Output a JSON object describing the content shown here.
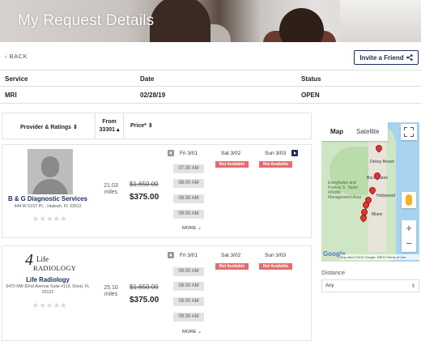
{
  "header": {
    "title": "My Request Details"
  },
  "nav": {
    "back_label": "BACK",
    "invite_label": "Invite a Friend",
    "invite_icon": "share-icon"
  },
  "request": {
    "headers": [
      "Service",
      "Date",
      "Status"
    ],
    "values": [
      "MRI",
      "02/28/19",
      "OPEN"
    ]
  },
  "list_header": {
    "provider": "Provider & Ratings",
    "from_label": "From",
    "from_zip": "33301",
    "price": "Price*"
  },
  "providers": [
    {
      "name": "B & G Diagnostic Services",
      "address": "444 W 51ST PL , Hialeah, FL 33012",
      "distance": "21.03",
      "distance_unit": "miles",
      "old_price": "$1,650.00",
      "price": "$375.00",
      "rating": 0,
      "days": [
        "Fri 3/01",
        "Sat 3/02",
        "Sun 3/03"
      ],
      "slots": [
        "07:30 AM",
        "08:00 AM",
        "08:30 AM",
        "09:00 AM"
      ],
      "unavailable": "Not Available",
      "more": "MORE ⌄"
    },
    {
      "name": "Life Radiology",
      "address": "5470 NW 82nd Avenue Suite #119, Doral, FL 33122",
      "logo_text": "Life",
      "logo_sub": "RADIOLOGY",
      "distance": "25.10",
      "distance_unit": "miles",
      "old_price": "$1,650.00",
      "price": "$375.00",
      "rating": 0,
      "days": [
        "Fri 3/01",
        "Sat 3/02",
        "Sun 3/03"
      ],
      "slots": [
        "08:00 AM",
        "08:30 AM",
        "09:00 AM",
        "09:30 AM"
      ],
      "unavailable": "Not Available",
      "more": "MORE ⌄"
    }
  ],
  "map": {
    "tab_map": "Map",
    "tab_satellite": "Satellite",
    "labels": [
      "Delray Beach",
      "Boca Raton",
      "Everglades and Francis S. Taylor Wildlife Management Area",
      "Hollywood",
      "Miami"
    ],
    "google": "Google",
    "attribution": "Map data ©2019 Google, INEGI   Terms of Use",
    "zoom_in": "+",
    "zoom_out": "−",
    "pin_color": "#d93a35"
  },
  "filters": {
    "distance_label": "Distance",
    "distance_value": "Any"
  },
  "colors": {
    "brand": "#1c2c5e",
    "unavailable": "#e86a6e",
    "slot_bg": "#e3e3e3"
  }
}
